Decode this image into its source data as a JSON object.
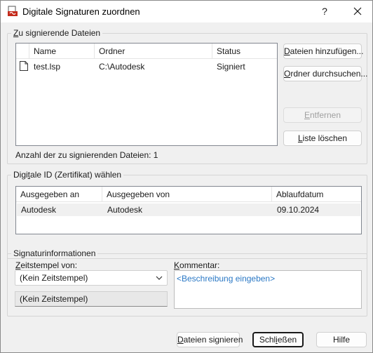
{
  "window": {
    "title": "Digitale Signaturen zuordnen",
    "help_glyph": "?",
    "close_glyph": "✕"
  },
  "files_group": {
    "label_underline": "Z",
    "label_rest": "u signierende Dateien",
    "columns": [
      "Name",
      "Ordner",
      "Status"
    ],
    "rows": [
      {
        "name": "test.lsp",
        "folder": "C:\\Autodesk",
        "status": "Signiert"
      }
    ],
    "buttons": {
      "add": {
        "u": "D",
        "rest": "ateien hinzufügen..."
      },
      "browse": {
        "u": "O",
        "rest": "rdner durchsuchen..."
      },
      "remove": {
        "pre": "",
        "u": "E",
        "rest": "ntfernen"
      },
      "clear": {
        "pre": "",
        "u": "L",
        "rest": "iste löschen"
      }
    },
    "count_text": "Anzahl der zu signierenden Dateien: 1"
  },
  "id_group": {
    "label_pre": "Digi",
    "label_underline": "t",
    "label_rest": "ale ID (Zertifikat) wählen",
    "columns": [
      "Ausgegeben an",
      "Ausgegeben von",
      "Ablaufdatum"
    ],
    "rows": [
      {
        "issued_to": "Autodesk",
        "issued_by": "Autodesk",
        "expires": "09.10.2024"
      }
    ]
  },
  "sig_group": {
    "label": "Signaturinformationen",
    "timestamp_label_u": "Z",
    "timestamp_label_rest": "eitstempel von:",
    "timestamp_value": "(Kein Zeitstempel)",
    "timestamp_readonly": "(Kein Zeitstempel)",
    "comment_label_u": "K",
    "comment_label_rest": "ommentar:",
    "comment_placeholder": "<Beschreibung eingeben>"
  },
  "footer": {
    "sign": {
      "u": "D",
      "rest": "ateien signieren"
    },
    "close": {
      "pre": "Schl",
      "u": "i",
      "rest": "eßen"
    },
    "help": "Hilfe"
  },
  "colors": {
    "accent": "#2a78c5",
    "selection_row": "#f0f0f0",
    "app_icon_red": "#c42b1c"
  }
}
